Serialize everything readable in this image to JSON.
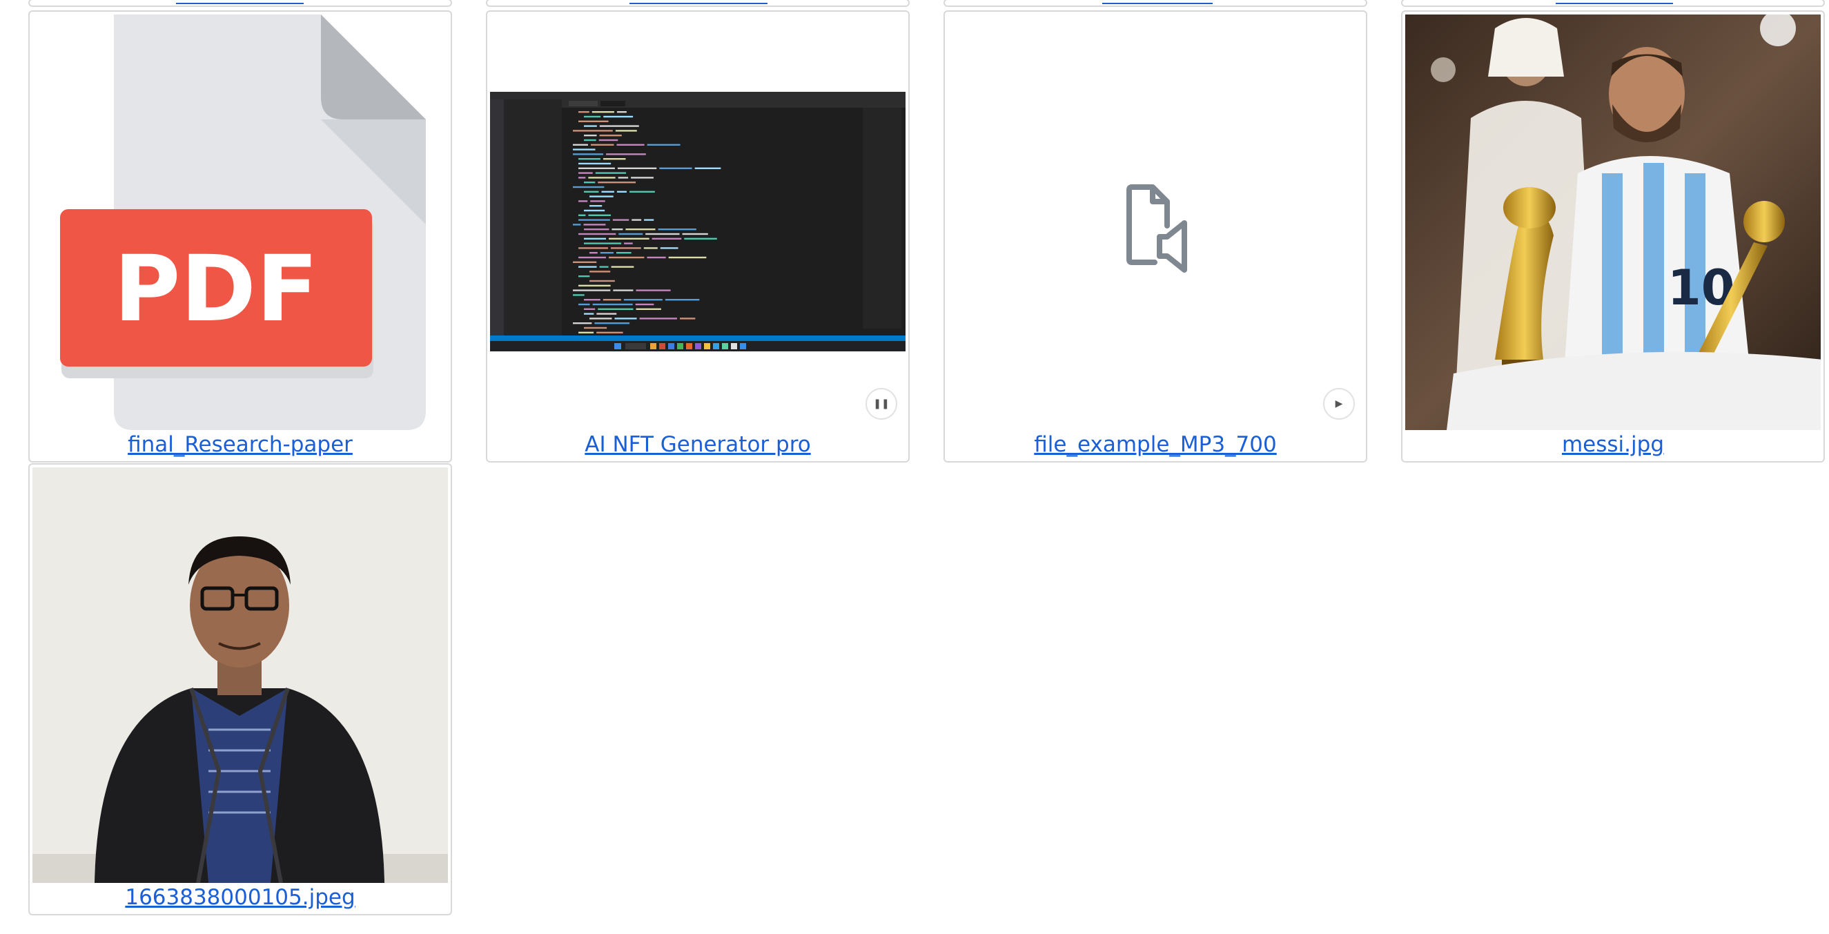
{
  "cards": {
    "top_row_links": [
      "",
      "",
      "",
      ""
    ],
    "pdf": {
      "name": "final_Research-paper",
      "badge": "PDF"
    },
    "video": {
      "name": "AI NFT Generator pro",
      "control_icon": "pause-icon"
    },
    "audio": {
      "name": "file_example_MP3_700",
      "control_icon": "play-icon"
    },
    "image1": {
      "name": "messi.jpg"
    },
    "image2": {
      "name": "1663838000105.jpeg"
    }
  },
  "colors": {
    "link": "#1a5fd6",
    "pdf_red": "#ef5645",
    "card_border": "#d8d8d8",
    "editor_bg": "#1e1e1e",
    "sky_blue": "#79b3e3"
  }
}
